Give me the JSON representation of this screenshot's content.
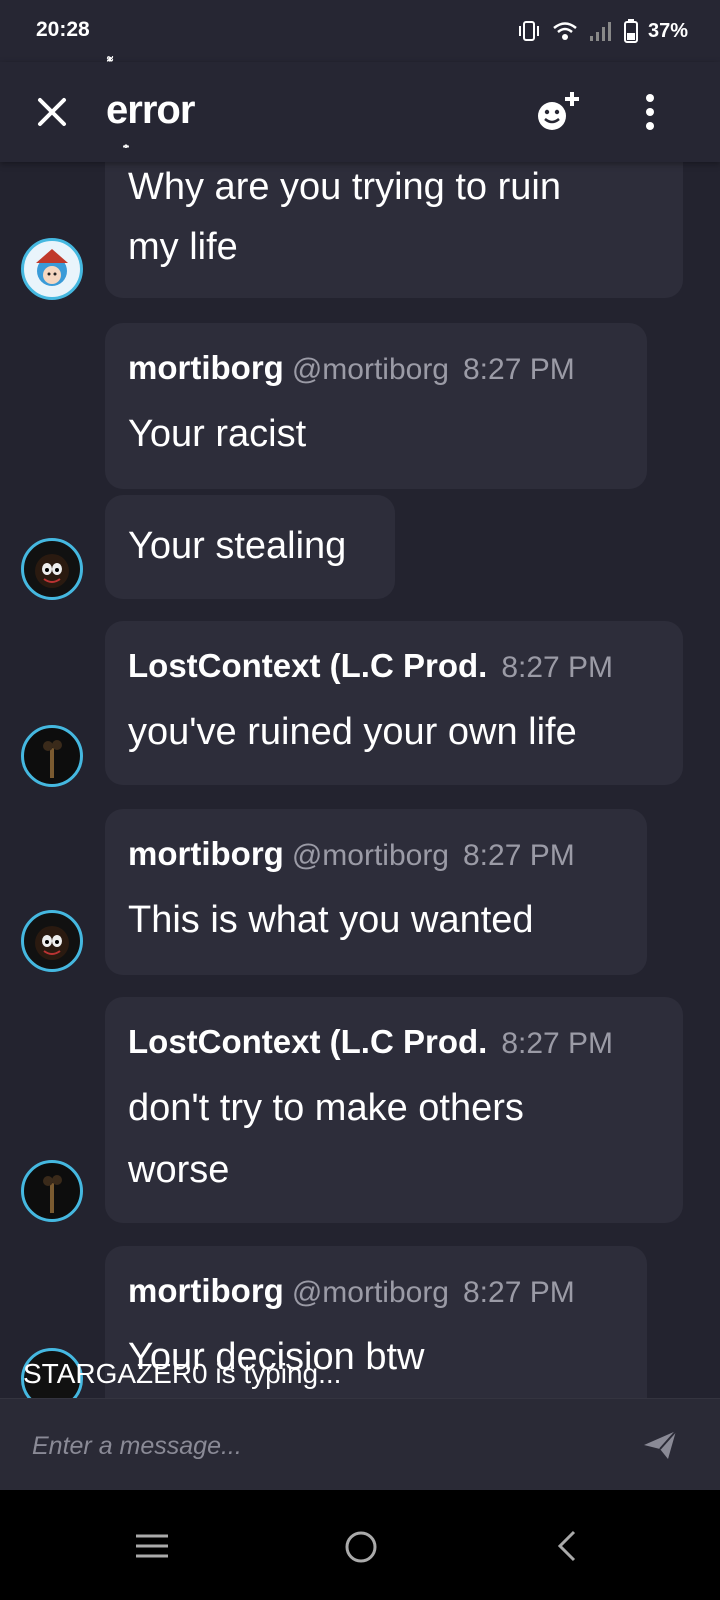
{
  "status_bar": {
    "time": "20:28",
    "battery": "37%"
  },
  "header": {
    "title": "error",
    "title_top_marks": "͌̾̽",
    "title_bottom_marks": "̥̦̤"
  },
  "messages": [
    {
      "lines": [
        "Why are you trying to ruin",
        "my life"
      ]
    },
    {
      "author": "mortiborg",
      "handle": "@mortiborg",
      "time": "8:27 PM",
      "lines": [
        "Your racist"
      ]
    },
    {
      "lines": [
        "Your stealing"
      ]
    },
    {
      "author": "LostContext (L.C Prod.",
      "time": "8:27 PM",
      "lines": [
        "you've ruined your own life"
      ]
    },
    {
      "author": "mortiborg",
      "handle": "@mortiborg",
      "time": "8:27 PM",
      "lines": [
        "This is what you wanted"
      ]
    },
    {
      "author": "LostContext (L.C Prod.",
      "time": "8:27 PM",
      "lines": [
        "don't try to make others",
        "worse"
      ]
    },
    {
      "author": "mortiborg",
      "handle": "@mortiborg",
      "time": "8:27 PM",
      "lines": [
        "Your decision btw"
      ]
    }
  ],
  "typing_indicator": "STARGAZER0 is typing...",
  "composer": {
    "placeholder": "Enter a message..."
  },
  "icons": {
    "close": "close-icon",
    "add_member": "add-member-icon",
    "more": "more-vertical-icon",
    "send": "send-icon",
    "nav_menu": "menu-icon",
    "nav_home": "home-circle-icon",
    "nav_back": "back-chevron-icon"
  },
  "colors": {
    "background": "#23232f",
    "bubble": "#2d2d3a",
    "accent": "#45b8e0",
    "muted": "#9b9ba6"
  }
}
